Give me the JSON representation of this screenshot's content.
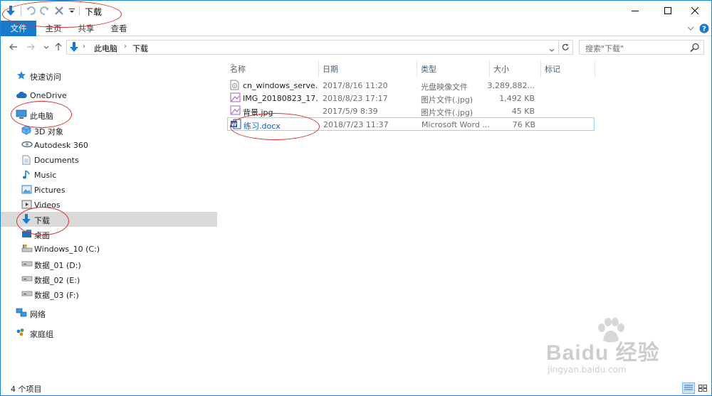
{
  "title_bar": {
    "title": "下载",
    "quick_access": [
      "down-arrow-icon",
      "undo-icon",
      "redo-icon",
      "delete-icon",
      "dropdown-icon"
    ],
    "window_controls": [
      "minimize-icon",
      "maximize-icon",
      "close-icon"
    ]
  },
  "ribbon": {
    "tabs": [
      "文件",
      "主页",
      "共享",
      "查看"
    ]
  },
  "address": {
    "path": [
      "此电脑",
      "下载"
    ],
    "search_placeholder": "搜索\"下载\""
  },
  "nav_pane": {
    "items": [
      {
        "label": "快速访问",
        "icon": "star-icon"
      },
      {
        "label": "OneDrive",
        "icon": "cloud-icon"
      },
      {
        "label": "此电脑",
        "icon": "pc-icon"
      },
      {
        "label": "3D 对象",
        "icon": "cube-icon"
      },
      {
        "label": "Autodesk 360",
        "icon": "autodesk-icon"
      },
      {
        "label": "Documents",
        "icon": "document-icon"
      },
      {
        "label": "Music",
        "icon": "music-icon"
      },
      {
        "label": "Pictures",
        "icon": "picture-icon"
      },
      {
        "label": "Videos",
        "icon": "video-icon"
      },
      {
        "label": "下载",
        "icon": "download-icon",
        "selected": true
      },
      {
        "label": "桌面",
        "icon": "desktop-icon"
      },
      {
        "label": "Windows_10 (C:)",
        "icon": "drive-c-icon"
      },
      {
        "label": "数据_01 (D:)",
        "icon": "drive-icon"
      },
      {
        "label": "数据_02 (E:)",
        "icon": "drive-icon"
      },
      {
        "label": "数据_03 (F:)",
        "icon": "drive-icon"
      },
      {
        "label": "网络",
        "icon": "network-icon"
      },
      {
        "label": "家庭组",
        "icon": "homegroup-icon"
      }
    ]
  },
  "file_list": {
    "columns": [
      "名称",
      "日期",
      "类型",
      "大小",
      "标记"
    ],
    "rows": [
      {
        "name": "cn_windows_serve...",
        "date": "2017/8/16 11:20",
        "type": "光盘映像文件",
        "size": "3,289,882...",
        "icon": "disc-image-icon"
      },
      {
        "name": "IMG_20180823_17...",
        "date": "2018/8/23 17:17",
        "type": "图片文件(.jpg)",
        "size": "1,492 KB",
        "icon": "image-file-icon"
      },
      {
        "name": "背景.jpg",
        "date": "2017/5/9 8:39",
        "type": "图片文件(.jpg)",
        "size": "45 KB",
        "icon": "image-file-icon"
      },
      {
        "name": "练习.docx",
        "date": "2018/7/23 11:37",
        "type": "Microsoft Word ...",
        "size": "76 KB",
        "icon": "word-doc-icon",
        "selected": true
      }
    ]
  },
  "status_bar": {
    "count_text": "4 个项目"
  },
  "watermark": {
    "big": "Baidu 经验",
    "small": "jingyan.baidu.com"
  },
  "colors": {
    "accent": "#1979ca",
    "annotation": "#d93030",
    "selected_nav": "#d9d9d9",
    "selected_row_border": "#99d1ff"
  }
}
